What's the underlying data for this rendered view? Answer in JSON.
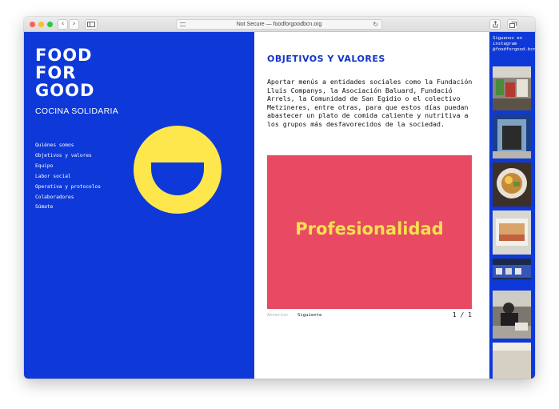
{
  "browser": {
    "back_icon": "‹",
    "forward_icon": "›",
    "url_text": "Not Secure — foodforgoodbcn.org",
    "reload_icon": "↻",
    "new_tab_icon": "+"
  },
  "sidebar": {
    "logo_line1": "FOOD",
    "logo_line2": "FOR",
    "logo_line3": "GOOD",
    "subtitle": "COCINA SOLIDARIA",
    "nav": [
      "Quiénes somos",
      "Objetivos y valores",
      "Equipo",
      "Labor social",
      "Operativa y protocolos",
      "Colaboradores",
      "Súmate"
    ]
  },
  "main": {
    "heading": "OBJETIVOS Y VALORES",
    "paragraph": "Aportar menús a entidades sociales como la Fundación Lluís Companys, la Asociación Baluard, Fundació Arrels, la Comunidad de San Egidio o el colectivo Metzineres, entre otras, para que estos días puedan abastecer un plato de comida caliente y nutritiva a los grupos más desfavorecidos de la sociedad.",
    "slide_text": "Profesionalidad",
    "prev_label": "Anterior",
    "next_label": "Siguiente",
    "page_counter": "1 / 1"
  },
  "instagram": {
    "label": "Síguenos en instagram @foodforgood.bcn"
  },
  "colors": {
    "brand_blue": "#0e39d8",
    "slide_pink": "#e84a63",
    "accent_yellow": "#fde74c"
  }
}
